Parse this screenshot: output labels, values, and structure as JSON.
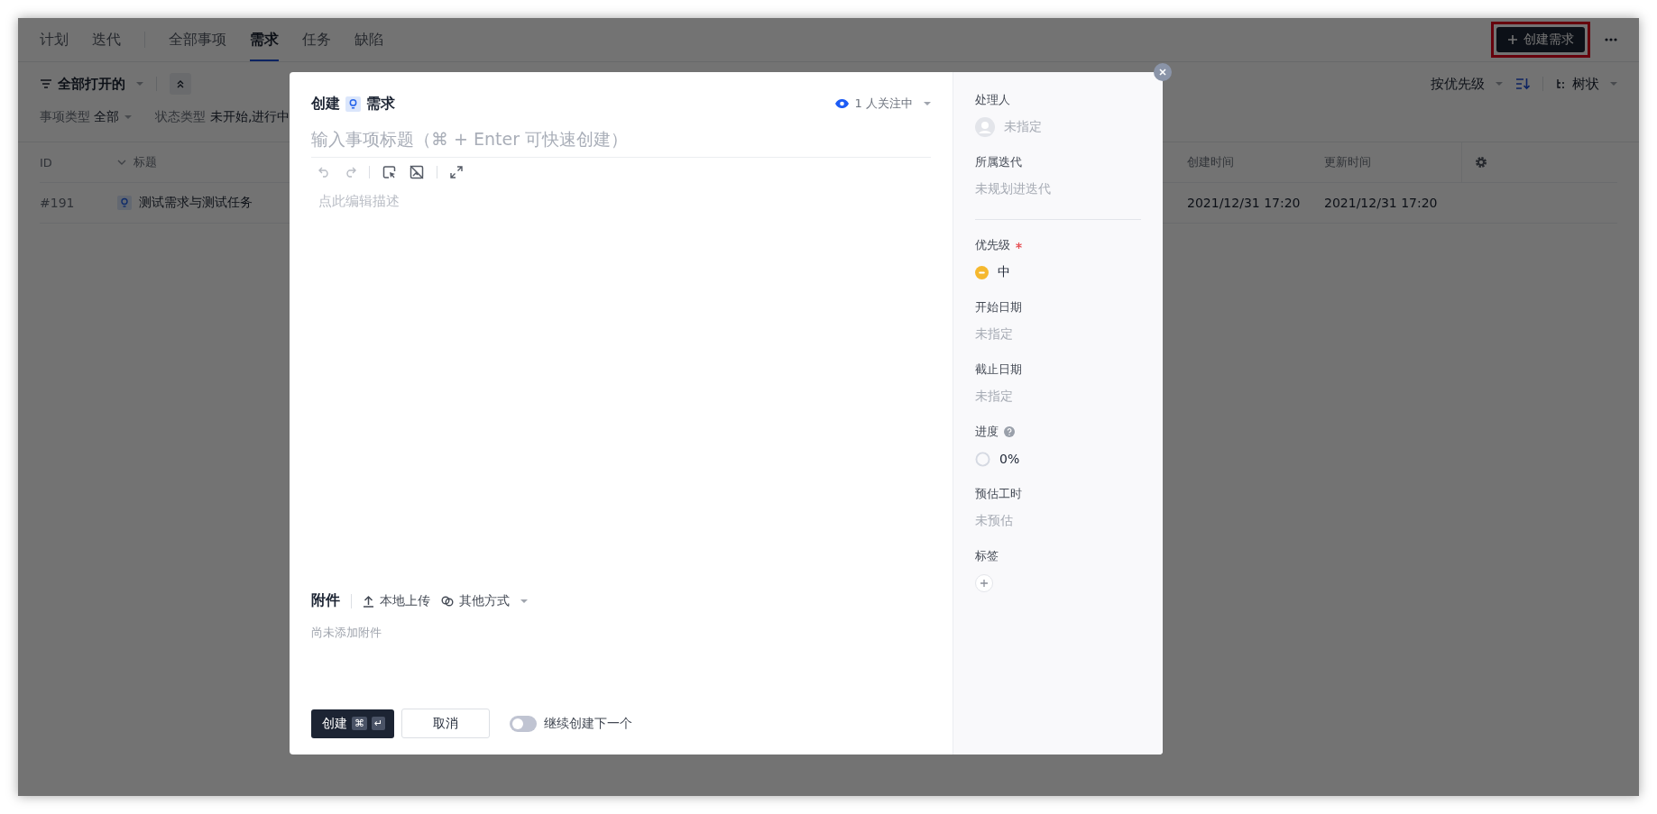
{
  "plan_tabs": [
    {
      "label": "计划",
      "selected": false
    },
    {
      "label": "迭代",
      "selected": false
    }
  ],
  "item_tabs": [
    {
      "label": "全部事项",
      "selected": false
    },
    {
      "label": "需求",
      "selected": true
    },
    {
      "label": "任务",
      "selected": false
    },
    {
      "label": "缺陷",
      "selected": false
    }
  ],
  "create_button": "创建需求",
  "filter": {
    "view": "全部打开的",
    "sort": "按优先级",
    "layout": "树状",
    "conditions": [
      {
        "label": "事项类型",
        "value": "全部",
        "has_caret": true
      },
      {
        "label": "状态类型",
        "value": "未开始,进行中",
        "has_caret": false
      }
    ]
  },
  "table": {
    "columns": [
      "ID",
      "标题",
      "创建时间",
      "更新时间"
    ],
    "rows": [
      {
        "cells": [
          "#191",
          "测试需求与测试任务",
          "2021/12/31 17:20",
          "2021/12/31 17:20"
        ]
      }
    ]
  },
  "modal": {
    "title": "创建",
    "type_label": "需求",
    "watchers": "1 人关注中",
    "title_placeholder": "输入事项标题（⌘ + Enter 可快速创建）",
    "description_placeholder": "点此编辑描述",
    "attachments": {
      "title": "附件",
      "upload": "本地上传",
      "other": "其他方式",
      "empty": "尚未添加附件"
    },
    "create_button": "创建",
    "create_shortcut": [
      "⌘",
      "↵"
    ],
    "cancel_button": "取消",
    "continue_toggle": {
      "label": "继续创建下一个",
      "on": false
    },
    "fields": [
      {
        "kind": "assignee",
        "label": "处理人",
        "placeholder": "未指定",
        "required": false,
        "help": false,
        "divider_after": false
      },
      {
        "kind": "text",
        "label": "所属迭代",
        "placeholder": "未规划进迭代",
        "required": false,
        "help": false,
        "divider_after": true
      },
      {
        "kind": "priority",
        "label": "优先级",
        "value": "中",
        "required": true,
        "help": false,
        "divider_after": false
      },
      {
        "kind": "text",
        "label": "开始日期",
        "placeholder": "未指定",
        "required": false,
        "help": false,
        "divider_after": false
      },
      {
        "kind": "text",
        "label": "截止日期",
        "placeholder": "未指定",
        "required": false,
        "help": false,
        "divider_after": false
      },
      {
        "kind": "progress",
        "label": "进度",
        "value": "0%",
        "required": false,
        "help": true,
        "divider_after": false
      },
      {
        "kind": "text",
        "label": "预估工时",
        "placeholder": "未预估",
        "required": false,
        "help": false,
        "divider_after": false
      },
      {
        "kind": "tags",
        "label": "标签",
        "required": false,
        "help": false,
        "divider_after": false
      }
    ]
  }
}
